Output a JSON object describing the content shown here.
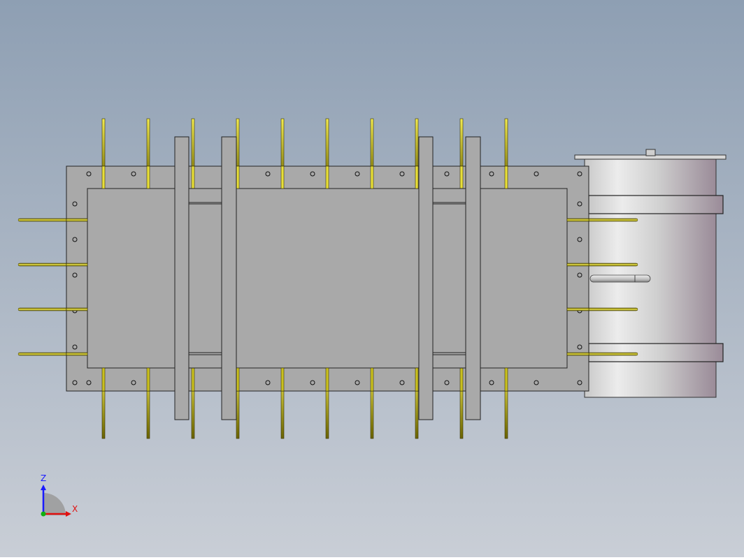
{
  "colors": {
    "background_top": "#8e9fb3",
    "background_bottom": "#c9ced6",
    "plate_fill": "#a9a9a9",
    "plate_stroke": "#222222",
    "rod_fill": "#e8df3a",
    "rod_stroke": "#3a3500",
    "cylinder_light": "#e6e6e6",
    "cylinder_dark": "#9a8b98",
    "axis_x": "#e01010",
    "axis_y": "#10b010",
    "axis_z": "#1a1aff"
  },
  "triad": {
    "z_label": "Z",
    "x_label": "X"
  },
  "model": {
    "vertical_rod_count": 10,
    "horizontal_rod_count_per_side": 4,
    "vertical_bar_count": 4,
    "component_names": [
      "base-plate",
      "top-plate",
      "vertical-bars",
      "vertical-rods",
      "horizontal-rods",
      "drum",
      "drum-clamps",
      "drum-pin",
      "drum-knob"
    ]
  }
}
